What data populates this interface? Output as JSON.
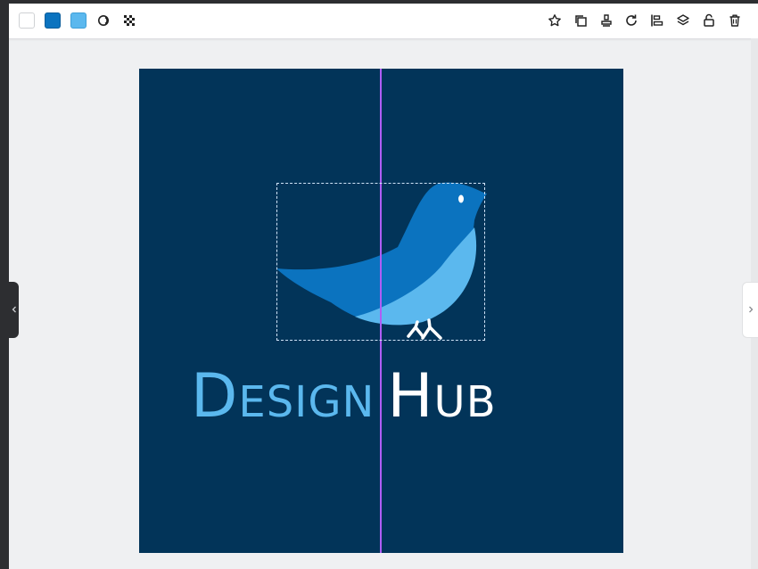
{
  "toolbar": {
    "swatches": [
      {
        "name": "white",
        "color": "#ffffff"
      },
      {
        "name": "blue",
        "color": "#0b73bf"
      },
      {
        "name": "light-blue",
        "color": "#5bb8ee"
      }
    ],
    "left_tools": [
      "color-picker-icon",
      "transparency-icon"
    ],
    "right_tools": [
      "star-icon",
      "duplicate-icon",
      "stamp-icon",
      "rotate-icon",
      "align-icon",
      "layers-icon",
      "lock-icon",
      "trash-icon"
    ]
  },
  "canvas": {
    "background": "#023459",
    "logo_text_part1": "Design",
    "logo_text_part2": "Hub",
    "text_color_part1": "#5bb8ee",
    "text_color_part2": "#ffffff",
    "bird_colors": {
      "body": "#0b73bf",
      "belly": "#5bb8ee",
      "feet": "#ffffff"
    }
  },
  "guide_color": "#b05df5"
}
